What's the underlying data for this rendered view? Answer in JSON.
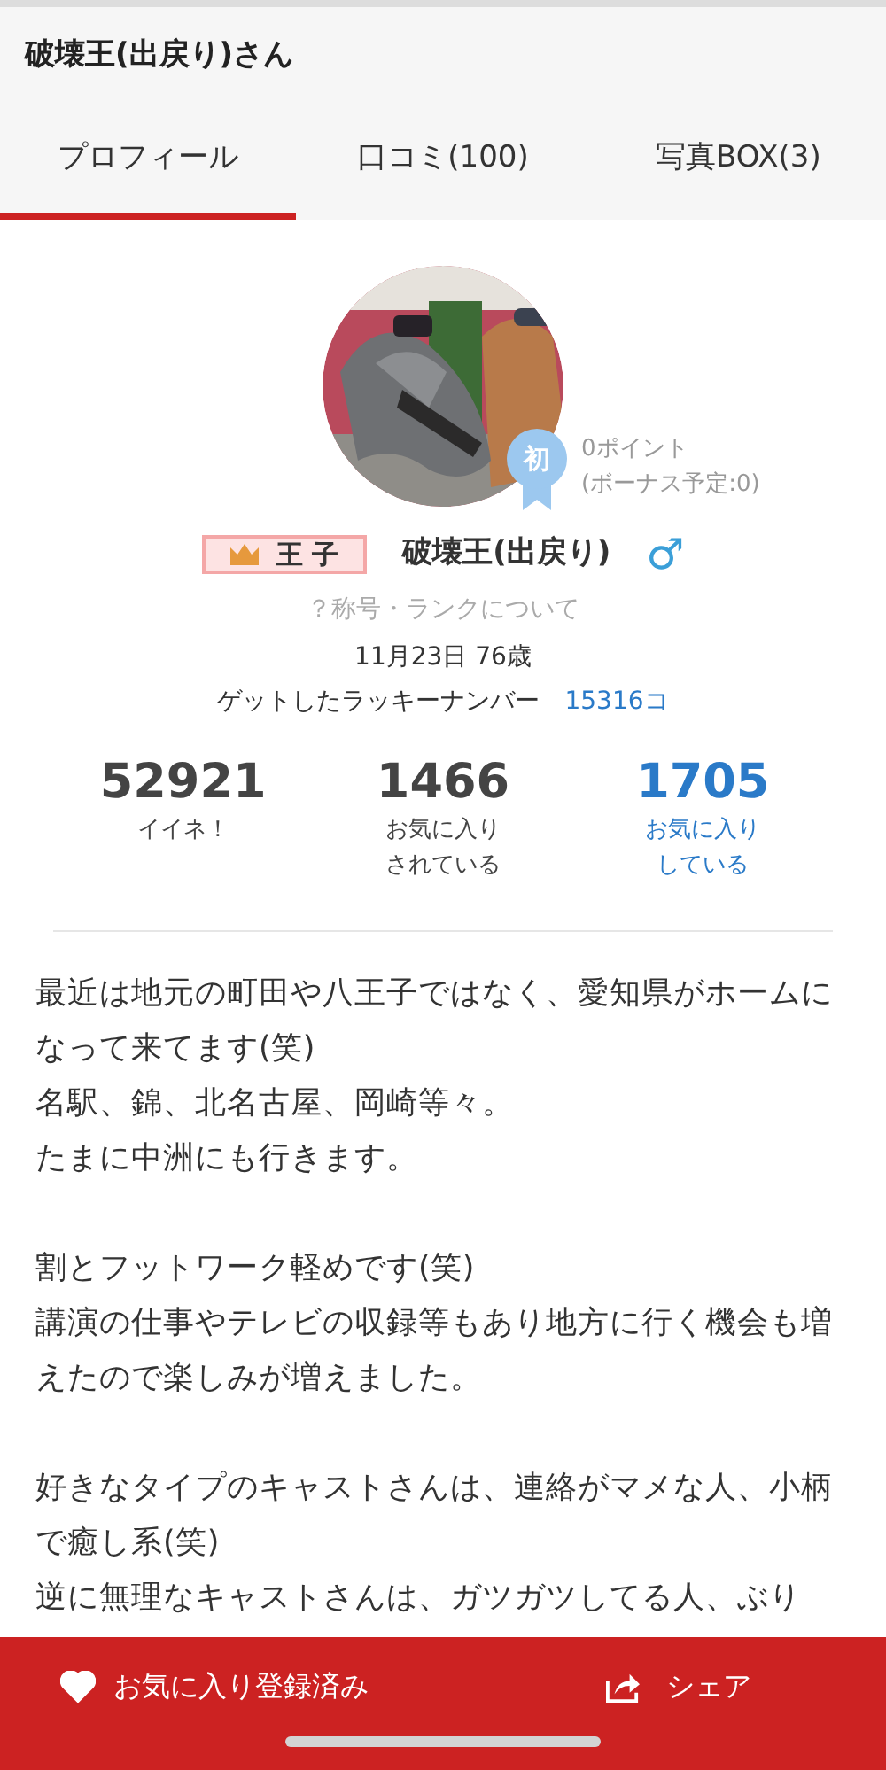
{
  "header": {
    "title": "破壊王(出戻り)さん"
  },
  "tabs": [
    {
      "label": "プロフィール",
      "selected": true
    },
    {
      "label": "口コミ(100)",
      "selected": false
    },
    {
      "label": "写真BOX(3)",
      "selected": false
    }
  ],
  "profile": {
    "badge": "初",
    "points": "0ポイント",
    "bonus": "(ボーナス予定:0)",
    "rank": "王 子",
    "name": "破壊王(出戻り)",
    "gender": "♂",
    "rank_link": "？称号・ランクについて",
    "birthday": "11月23日 76歳",
    "lucky_label": "ゲットしたラッキーナンバー",
    "lucky_value": "15316コ"
  },
  "stats": [
    {
      "value": "52921",
      "label": "イイネ！",
      "highlight": false
    },
    {
      "value": "1466",
      "label": "お気に入りされている",
      "highlight": false
    },
    {
      "value": "1705",
      "label": "お気に入りしている",
      "highlight": true
    }
  ],
  "bio": [
    [
      "最近は地元の町田や八王子ではなく、愛知県がホームになって来てます(笑)",
      "名駅、錦、北名古屋、岡崎等々。",
      "たまに中洲にも行きます。"
    ],
    [
      "割とフットワーク軽めです(笑)",
      "講演の仕事やテレビの収録等もあり地方に行く機会も増えたので楽しみが増えました。"
    ],
    [
      "好きなタイプのキャストさんは、連絡がマメな人、小柄で癒し系(笑)",
      "逆に無理なキャストさんは、ガツガツしてる人、ぶり"
    ]
  ],
  "actions": {
    "favorite": "お気に入り登録済み",
    "favorited": true,
    "share": "シェア"
  }
}
